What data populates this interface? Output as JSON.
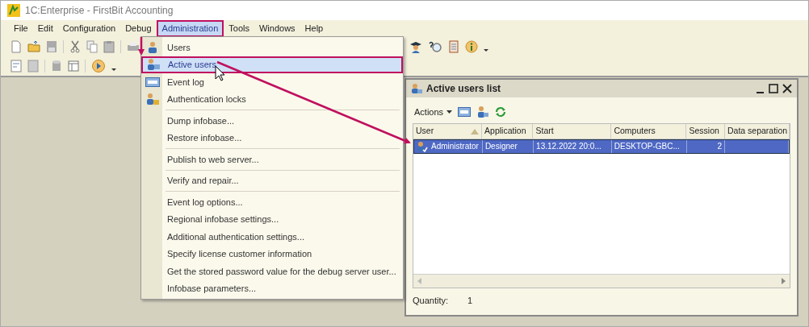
{
  "window": {
    "title": "1C:Enterprise - FirstBit Accounting"
  },
  "menubar": [
    {
      "label": "File",
      "selected": false
    },
    {
      "label": "Edit",
      "selected": false
    },
    {
      "label": "Configuration",
      "selected": false
    },
    {
      "label": "Debug",
      "selected": false
    },
    {
      "label": "Administration",
      "selected": true
    },
    {
      "label": "Tools",
      "selected": false
    },
    {
      "label": "Windows",
      "selected": false
    },
    {
      "label": "Help",
      "selected": false
    }
  ],
  "menu": {
    "groups": [
      [
        {
          "label": "Users",
          "selected": false
        },
        {
          "label": "Active users",
          "selected": true
        },
        {
          "label": "Event log",
          "selected": false
        },
        {
          "label": "Authentication locks",
          "selected": false
        }
      ],
      [
        {
          "label": "Dump infobase...",
          "selected": false
        },
        {
          "label": "Restore infobase...",
          "selected": false
        }
      ],
      [
        {
          "label": "Publish to web server...",
          "selected": false
        }
      ],
      [
        {
          "label": "Verify and repair...",
          "selected": false
        }
      ],
      [
        {
          "label": "Event log options...",
          "selected": false
        },
        {
          "label": "Regional infobase settings...",
          "selected": false
        },
        {
          "label": "Additional authentication settings...",
          "selected": false
        },
        {
          "label": "Specify license customer information",
          "selected": false
        },
        {
          "label": "Get the stored password value for the debug server user...",
          "selected": false
        },
        {
          "label": "Infobase parameters...",
          "selected": false
        }
      ]
    ]
  },
  "child_window": {
    "title": "Active users list",
    "actions_label": "Actions",
    "table": {
      "columns": [
        {
          "label": "User",
          "sorted": true
        },
        {
          "label": "Application",
          "sorted": false
        },
        {
          "label": "Start",
          "sorted": false
        },
        {
          "label": "Computers",
          "sorted": false
        },
        {
          "label": "Session",
          "sorted": false
        },
        {
          "label": "Data separation",
          "sorted": false
        }
      ],
      "rows": [
        {
          "selected": true,
          "cells": [
            "Administrator",
            "Designer",
            "13.12.2022 20:0...",
            "DESKTOP-GBC...",
            "2",
            ""
          ]
        }
      ]
    },
    "quantity_label": "Quantity:",
    "quantity_value": "1"
  }
}
